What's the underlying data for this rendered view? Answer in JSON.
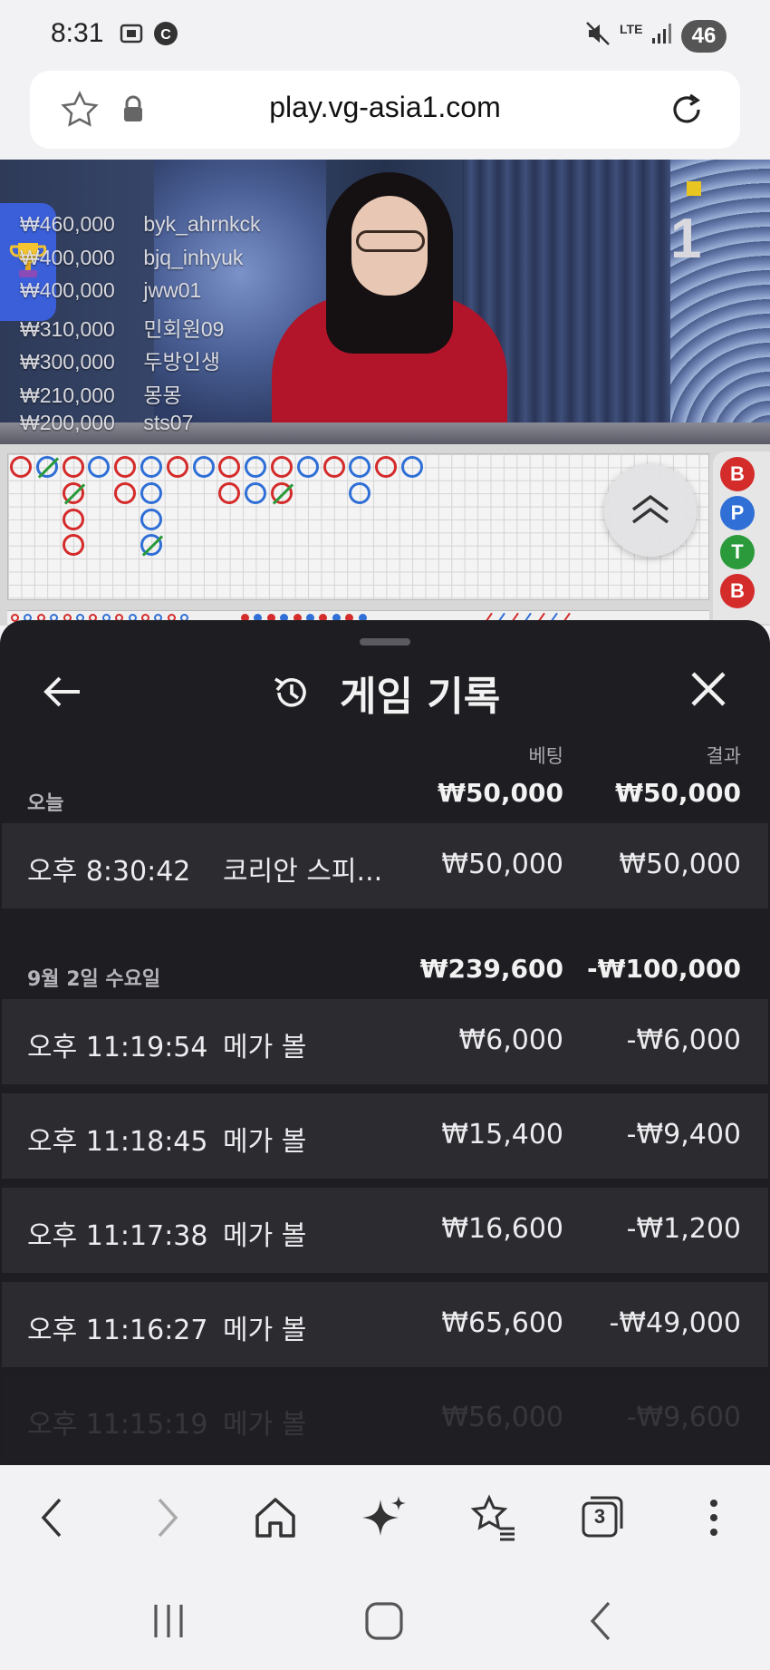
{
  "status_bar": {
    "time": "8:31",
    "battery": "46",
    "network": "LTE"
  },
  "browser": {
    "url": "play.vg-asia1.com"
  },
  "video": {
    "round_number": "1",
    "winners": [
      {
        "amount": "₩460,000",
        "user": "byk_ahrnkck"
      },
      {
        "amount": "₩400,000",
        "user": "bjq_inhyuk"
      },
      {
        "amount": "₩400,000",
        "user": "jww01"
      },
      {
        "amount": "₩310,000",
        "user": "민회원09"
      },
      {
        "amount": "₩300,000",
        "user": "두방인생"
      },
      {
        "amount": "₩210,000",
        "user": "몽몽"
      },
      {
        "amount": "₩200,000",
        "user": "sts07"
      }
    ]
  },
  "side_panel": {
    "chips": [
      "B",
      "P",
      "T",
      "B"
    ],
    "colors": {
      "B": "#d42b2b",
      "P": "#2f6fd6",
      "T": "#2a9a3a"
    }
  },
  "sheet": {
    "title": "게임 기록",
    "col_bet": "베팅",
    "col_result": "결과",
    "groups": [
      {
        "label": "오늘",
        "bet_total": "₩50,000",
        "result_total": "₩50,000",
        "rows": [
          {
            "time": "오후 8:30:42",
            "game": "코리안 스피...",
            "bet": "₩50,000",
            "result": "₩50,000"
          }
        ]
      },
      {
        "label": "9월 2일 수요일",
        "bet_total": "₩239,600",
        "result_total": "-₩100,000",
        "rows": [
          {
            "time": "오후 11:19:54",
            "game": "메가 볼",
            "bet": "₩6,000",
            "result": "-₩6,000"
          },
          {
            "time": "오후 11:18:45",
            "game": "메가 볼",
            "bet": "₩15,400",
            "result": "-₩9,400"
          },
          {
            "time": "오후 11:17:38",
            "game": "메가 볼",
            "bet": "₩16,600",
            "result": "-₩1,200"
          },
          {
            "time": "오후 11:16:27",
            "game": "메가 볼",
            "bet": "₩65,600",
            "result": "-₩49,000"
          },
          {
            "time": "오후 11:15:19",
            "game": "메가 볼",
            "bet": "₩56,000",
            "result": "-₩9,600"
          }
        ]
      }
    ]
  },
  "toolbar": {
    "tabs_count": "3"
  }
}
